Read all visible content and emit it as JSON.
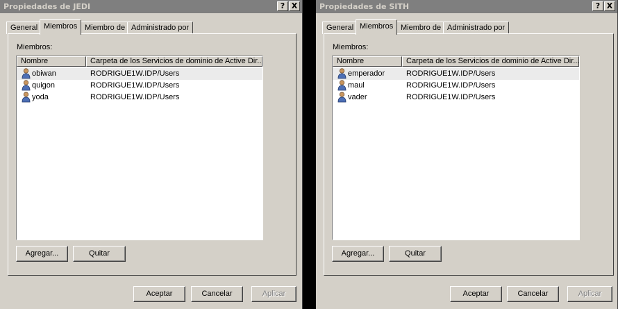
{
  "dialogs": [
    {
      "title": "Propiedades de JEDI",
      "help_glyph": "?",
      "close_glyph": "X",
      "tabs": [
        "General",
        "Miembros",
        "Miembro de",
        "Administrado por"
      ],
      "active_tab": "Miembros",
      "members_label": "Miembros:",
      "columns": [
        "Nombre",
        "Carpeta de los Servicios de dominio de Active Dir..."
      ],
      "rows": [
        {
          "name": "obiwan",
          "folder": "RODRIGUE1W.IDP/Users",
          "selected": true
        },
        {
          "name": "quigon",
          "folder": "RODRIGUE1W.IDP/Users",
          "selected": false
        },
        {
          "name": "yoda",
          "folder": "RODRIGUE1W.IDP/Users",
          "selected": false
        }
      ],
      "add_label": "Agregar...",
      "remove_label": "Quitar",
      "ok_label": "Aceptar",
      "cancel_label": "Cancelar",
      "apply_label": "Aplicar"
    },
    {
      "title": "Propiedades de SITH",
      "help_glyph": "?",
      "close_glyph": "X",
      "tabs": [
        "General",
        "Miembros",
        "Miembro de",
        "Administrado por"
      ],
      "active_tab": "Miembros",
      "members_label": "Miembros:",
      "columns": [
        "Nombre",
        "Carpeta de los Servicios de dominio de Active Dir..."
      ],
      "rows": [
        {
          "name": "emperador",
          "folder": "RODRIGUE1W.IDP/Users",
          "selected": true
        },
        {
          "name": "maul",
          "folder": "RODRIGUE1W.IDP/Users",
          "selected": false
        },
        {
          "name": "vader",
          "folder": "RODRIGUE1W.IDP/Users",
          "selected": false
        }
      ],
      "add_label": "Agregar...",
      "remove_label": "Quitar",
      "ok_label": "Aceptar",
      "cancel_label": "Cancelar",
      "apply_label": "Aplicar"
    }
  ],
  "colors": {
    "dialog_bg": "#d4d0c8",
    "inactive_title_bg": "#7f7f7f",
    "selected_row_bg": "#ebebeb"
  },
  "icons": {
    "user": "user-icon",
    "help": "help-icon",
    "close": "close-icon"
  }
}
